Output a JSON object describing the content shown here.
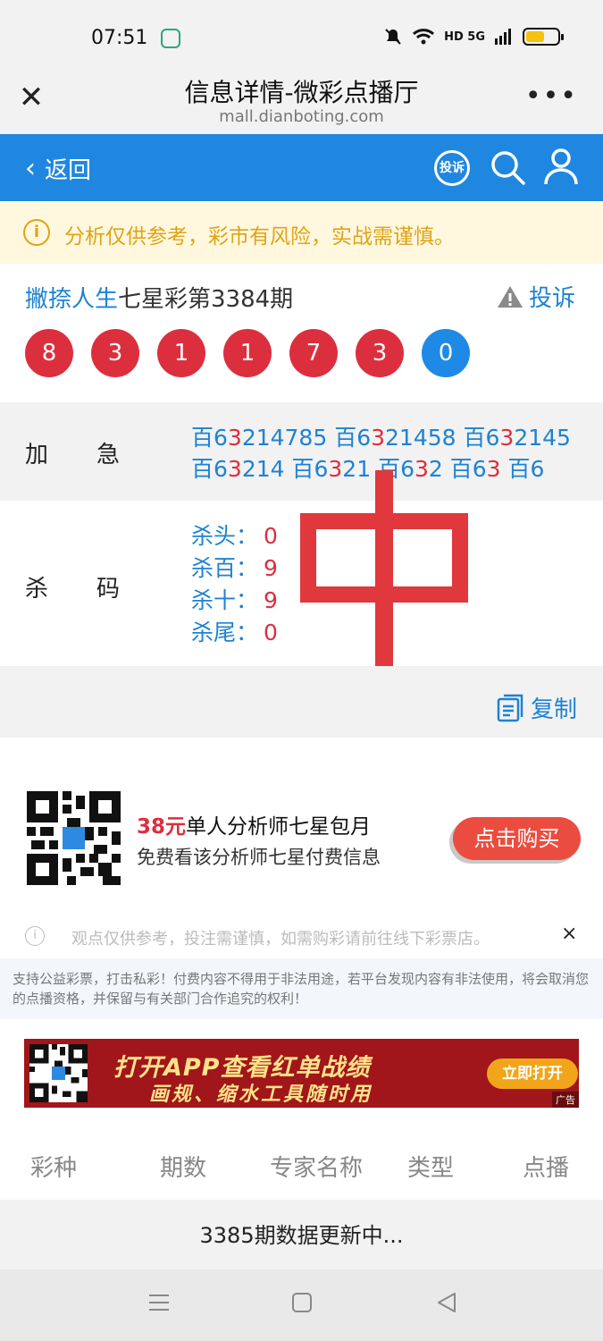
{
  "status_bar": {
    "time": "07:51",
    "network": "HD 5G",
    "icons": [
      "app-notification-icon",
      "mute-icon",
      "wifi-icon",
      "signal-icon",
      "battery-icon"
    ],
    "battery_level": 0.6
  },
  "browser": {
    "title": "信息详情-微彩点播厅",
    "url": "mall.dianboting.com",
    "close_icon": "close-icon",
    "more_icon": "more-icon"
  },
  "nav": {
    "back_label": "返回",
    "complain_badge": "投诉",
    "search_icon": "search-icon",
    "user_icon": "user-icon",
    "color": "#1f87e0"
  },
  "notice": {
    "text": "分析仅供参考，彩市有风险，实战需谨慎。"
  },
  "post": {
    "author": "撇捺人生",
    "title_rest": "七星彩第3384期",
    "complain_label": "投诉",
    "balls": [
      {
        "value": "8",
        "color": "red"
      },
      {
        "value": "3",
        "color": "red"
      },
      {
        "value": "1",
        "color": "red"
      },
      {
        "value": "1",
        "color": "red"
      },
      {
        "value": "7",
        "color": "red"
      },
      {
        "value": "3",
        "color": "red"
      },
      {
        "value": "0",
        "color": "blue"
      }
    ]
  },
  "jiaji": {
    "label_a": "加",
    "label_b": "急",
    "items": [
      {
        "pre": "百6",
        "hot": "3",
        "post": "214785"
      },
      {
        "pre": "百6",
        "hot": "3",
        "post": "21458"
      },
      {
        "pre": "百6",
        "hot": "3",
        "post": "2145"
      },
      {
        "pre": "百6",
        "hot": "3",
        "post": "214"
      },
      {
        "pre": "百6",
        "hot": "3",
        "post": "21"
      },
      {
        "pre": "百6",
        "hot": "3",
        "post": "2"
      },
      {
        "pre": "百6",
        "hot": "3",
        "post": ""
      },
      {
        "pre": "百6",
        "hot": "",
        "post": ""
      }
    ]
  },
  "shama": {
    "label_a": "杀",
    "label_b": "码",
    "items": [
      {
        "key": "杀头：",
        "value": "0"
      },
      {
        "key": "杀百：",
        "value": "9"
      },
      {
        "key": "杀十：",
        "value": "9"
      },
      {
        "key": "杀尾：",
        "value": "0"
      }
    ],
    "stamp": "中"
  },
  "copy": {
    "label": "复制"
  },
  "promo": {
    "price": "38元",
    "line1_rest": "单人分析师七星包月",
    "line2": "免费看该分析师七星付费信息",
    "button": "点击购买"
  },
  "disclaimer": {
    "line": "观点仅供参考，投注需谨慎，如需购彩请前往线下彩票店。",
    "close": "×",
    "legal": "支持公益彩票，打击私彩！付费内容不得用于非法用途，若平台发现内容有非法使用，将会取消您的点播资格，并保留与有关部门合作追究的权利！"
  },
  "banner": {
    "headline": "打开APP查看红单战绩",
    "subline": "画规、缩水工具随时用",
    "button": "立即打开",
    "ad_tag": "广告"
  },
  "table": {
    "headers": [
      "彩种",
      "期数",
      "专家名称",
      "类型",
      "点播"
    ],
    "message": "3385期数据更新中..."
  }
}
